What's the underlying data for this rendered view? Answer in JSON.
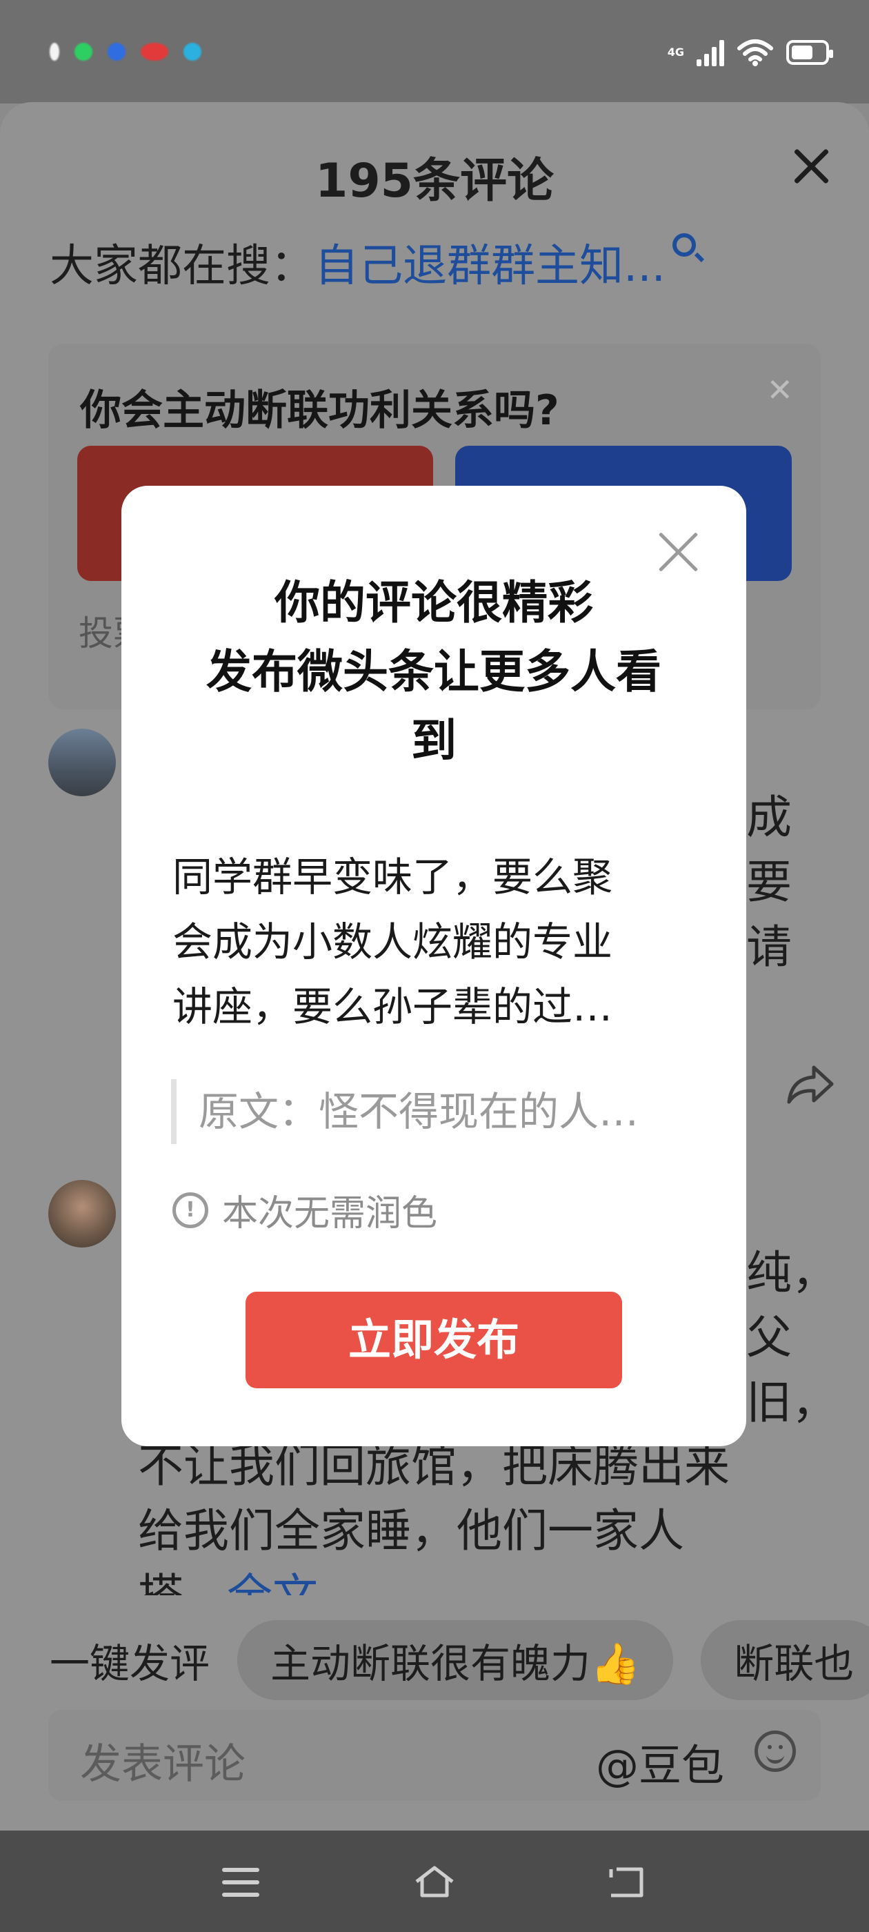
{
  "sheet": {
    "title": "195条评论",
    "search_prefix": "大家都在搜：",
    "search_query": "自己退群群主知..."
  },
  "poll": {
    "question": "你会主动断联功利关系吗?",
    "footer_fragment": "投票"
  },
  "comment1": {
    "visible_lines": [
      "成",
      "要",
      "请"
    ]
  },
  "comment2": {
    "line_fragments": [
      "纯，",
      "父",
      "旧，"
    ],
    "lines": [
      "不让我们回旅馆，把床腾出来",
      "给我们全家睡，他们一家人"
    ],
    "last_line": "搭",
    "more_label": "全文"
  },
  "quick_comments": {
    "label": "一键发评",
    "chips": [
      "主动断联很有魄力👍",
      "断联也"
    ]
  },
  "input": {
    "placeholder": "发表评论",
    "mention": "@豆包"
  },
  "modal": {
    "title_lines": [
      "你的评论很精彩",
      "发布微头条让更多人看",
      "到"
    ],
    "body_lines": [
      "同学群早变味了，要么聚",
      "会成为小数人炫耀的专业",
      "讲座，要么孙子辈的过…"
    ],
    "quote": "原文：怪不得现在的人…",
    "tip": "本次无需润色",
    "publish_label": "立即发布"
  },
  "colors": {
    "accent_red": "#ea5248",
    "link_blue": "#1e4d9c",
    "overlay_gray": "#929292"
  }
}
